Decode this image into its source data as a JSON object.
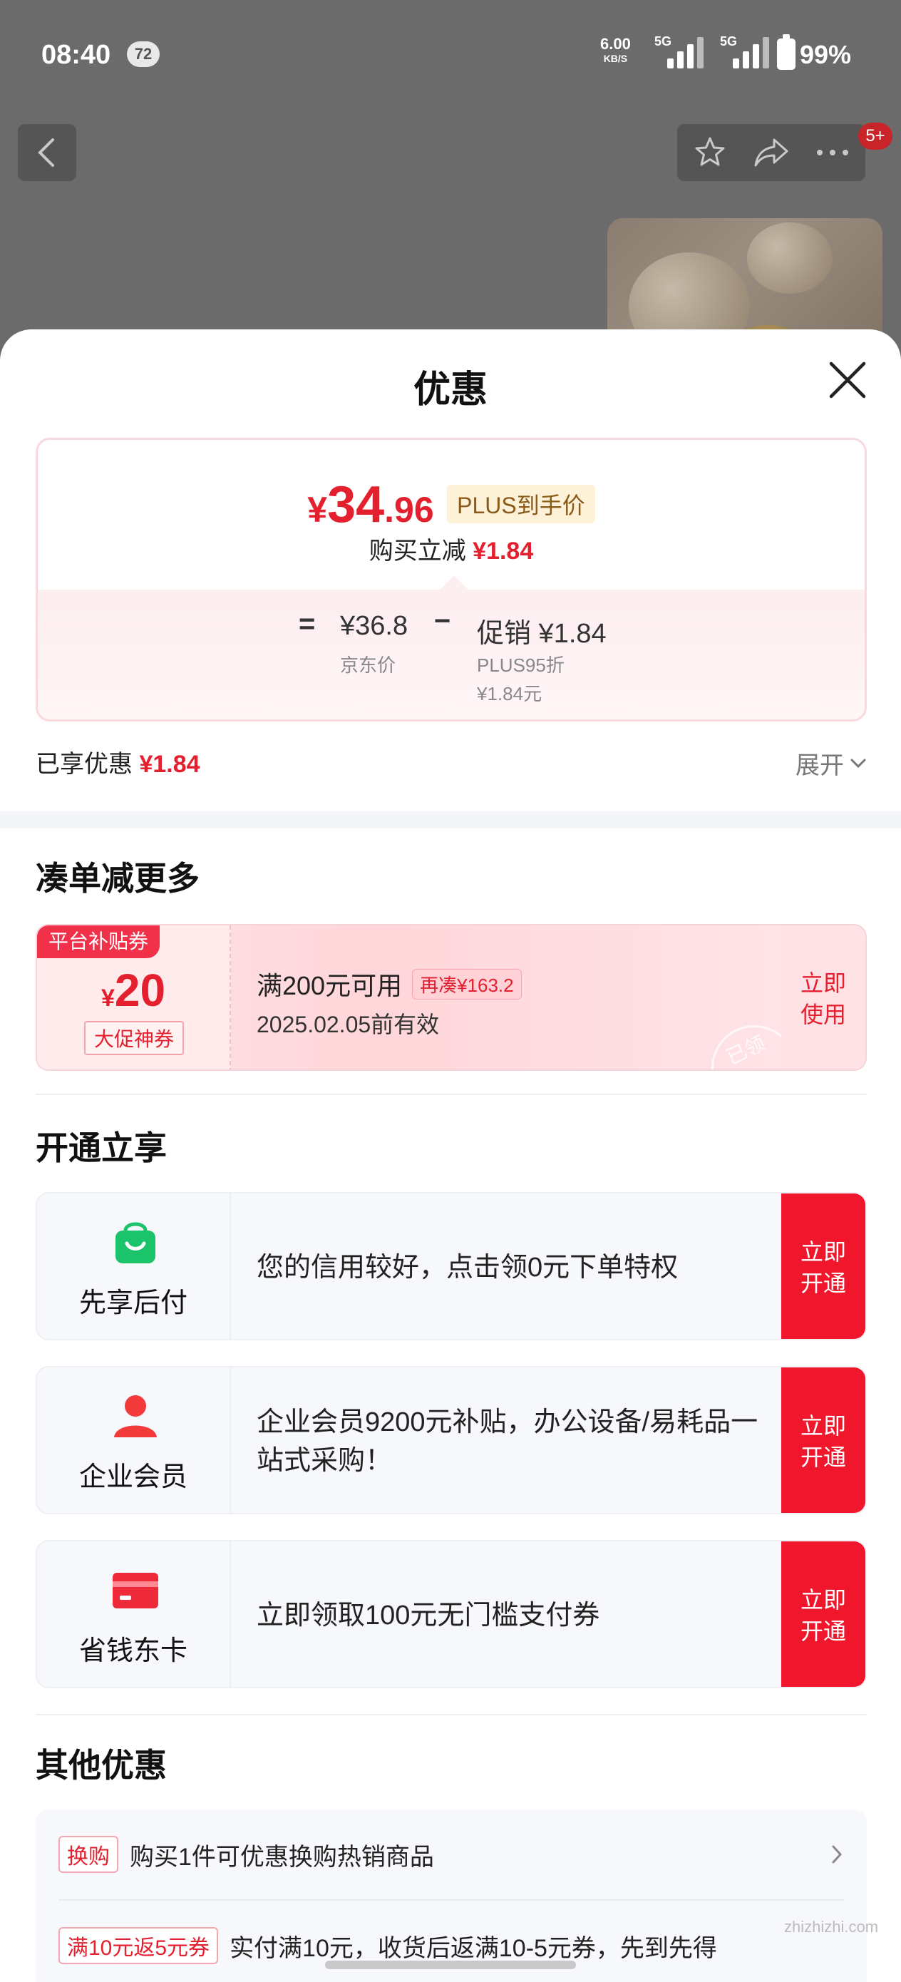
{
  "status_bar": {
    "time": "08:40",
    "notification_count": "72",
    "net_speed": "6.00",
    "net_speed_unit": "KB/S",
    "net_type_1": "5G",
    "net_type_2": "5G",
    "battery": "99%"
  },
  "top_nav": {
    "back_icon": "chevron-left-icon",
    "actions": [
      "star-icon",
      "share-icon",
      "more-icon"
    ],
    "message_badge": "5+"
  },
  "sheet": {
    "title": "优惠",
    "close_icon": "close-icon",
    "price_card": {
      "currency": "¥",
      "price_integer": "34",
      "price_decimal": ".96",
      "plus_tag": "PLUS到手价",
      "buy_reduce_label": "购买立减",
      "buy_reduce_value": "¥1.84",
      "equals": "=",
      "jd_price": "¥36.8",
      "jd_price_label": "京东价",
      "minus": "−",
      "promo": "促销 ¥1.84",
      "promo_detail_1": "PLUS95折",
      "promo_detail_2": "¥1.84元"
    },
    "enjoyed_label": "已享优惠",
    "enjoyed_value": "¥1.84",
    "expand_label": "展开",
    "section_more": {
      "title": "凑单减更多",
      "coupon": {
        "ribbon": "平台补贴券",
        "currency": "¥",
        "amount": "20",
        "tag": "大促神券",
        "condition": "满200元可用",
        "more_needed": "再凑¥163.2",
        "valid_until": "2025.02.05前有效",
        "stamp": "已领",
        "button": "立即使用"
      }
    },
    "section_open": {
      "title": "开通立享",
      "cards": [
        {
          "name": "先享后付",
          "icon": "shopping-bag-icon",
          "desc": "您的信用较好，点击领0元下单特权",
          "button": "立即开通"
        },
        {
          "name": "企业会员",
          "icon": "person-icon",
          "desc": "企业会员9200元补贴，办公设备/易耗品一站式采购！",
          "button": "立即开通"
        },
        {
          "name": "省钱东卡",
          "icon": "card-icon",
          "desc": "立即领取100元无门槛支付券",
          "button": "立即开通"
        }
      ]
    },
    "section_other": {
      "title": "其他优惠",
      "rows": [
        {
          "tag": "换购",
          "text": "购买1件可优惠换购热销商品"
        },
        {
          "tag": "满10元返5元券",
          "text": "实付满10元，收货后返满10-5元券，先到先得"
        }
      ]
    }
  },
  "watermark": "zhizhizhi.com",
  "colors": {
    "accent_red": "#e4202f",
    "button_red": "#f0162c",
    "plus_gold_bg": "#fdf1d8",
    "plus_gold_text": "#8a5a19"
  }
}
